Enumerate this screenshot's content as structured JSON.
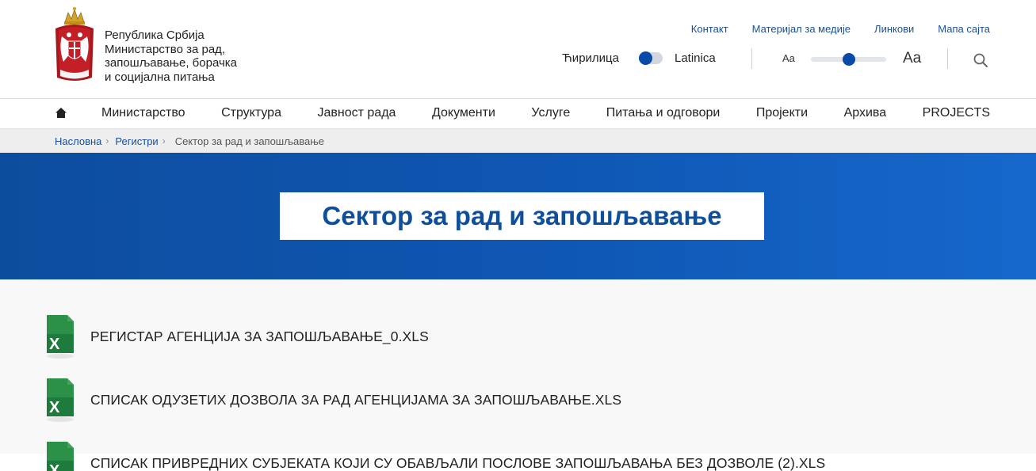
{
  "header": {
    "logo_lines": [
      "Република Србија",
      "Министарство за рад,",
      "запошљавање, борачка",
      "и социјална питања"
    ],
    "top_links": [
      "Контакт",
      "Материјал за медије",
      "Линкови",
      "Мапа сајта"
    ],
    "lang_cyrillic": "Ћирилица",
    "lang_latin": "Latinica",
    "font_small": "Aa",
    "font_large": "Aa"
  },
  "nav": {
    "items": [
      "Министарство",
      "Структура",
      "Јавност рада",
      "Документи",
      "Услуге",
      "Питања и одговори",
      "Пројекти",
      "Архива",
      "PROJECTS"
    ]
  },
  "breadcrumb": {
    "items": [
      "Насловна",
      "Регистри"
    ],
    "current": "Сектор за рад и запошљавање"
  },
  "hero": {
    "title": "Сектор за рад и запошљавање"
  },
  "documents": [
    {
      "name": "РЕГИСТАР АГЕНЦИЈА ЗА ЗАПОШЉАВАЊЕ_0.XLS"
    },
    {
      "name": "СПИСАК ОДУЗЕТИХ ДОЗВОЛА ЗА РАД АГЕНЦИЈАМА ЗА ЗАПОШЉАВАЊЕ.XLS"
    },
    {
      "name": "СПИСАК ПРИВРЕДНИХ СУБЈЕКАТА КОЈИ СУ ОБАВЉАЛИ ПОСЛОВЕ ЗАПОШЉАВАЊА БЕЗ ДОЗВОЛЕ (2).XLS"
    }
  ],
  "colors": {
    "brand_blue": "#0e4f9c",
    "link_blue": "#1a4f96",
    "hero_gradient_start": "#0d4d9e",
    "hero_gradient_end": "#1668cc",
    "excel_green": "#1f7a3d"
  },
  "icons": [
    "coat-of-arms-icon",
    "search-icon",
    "home-icon",
    "chevron-right-icon",
    "excel-file-icon"
  ]
}
